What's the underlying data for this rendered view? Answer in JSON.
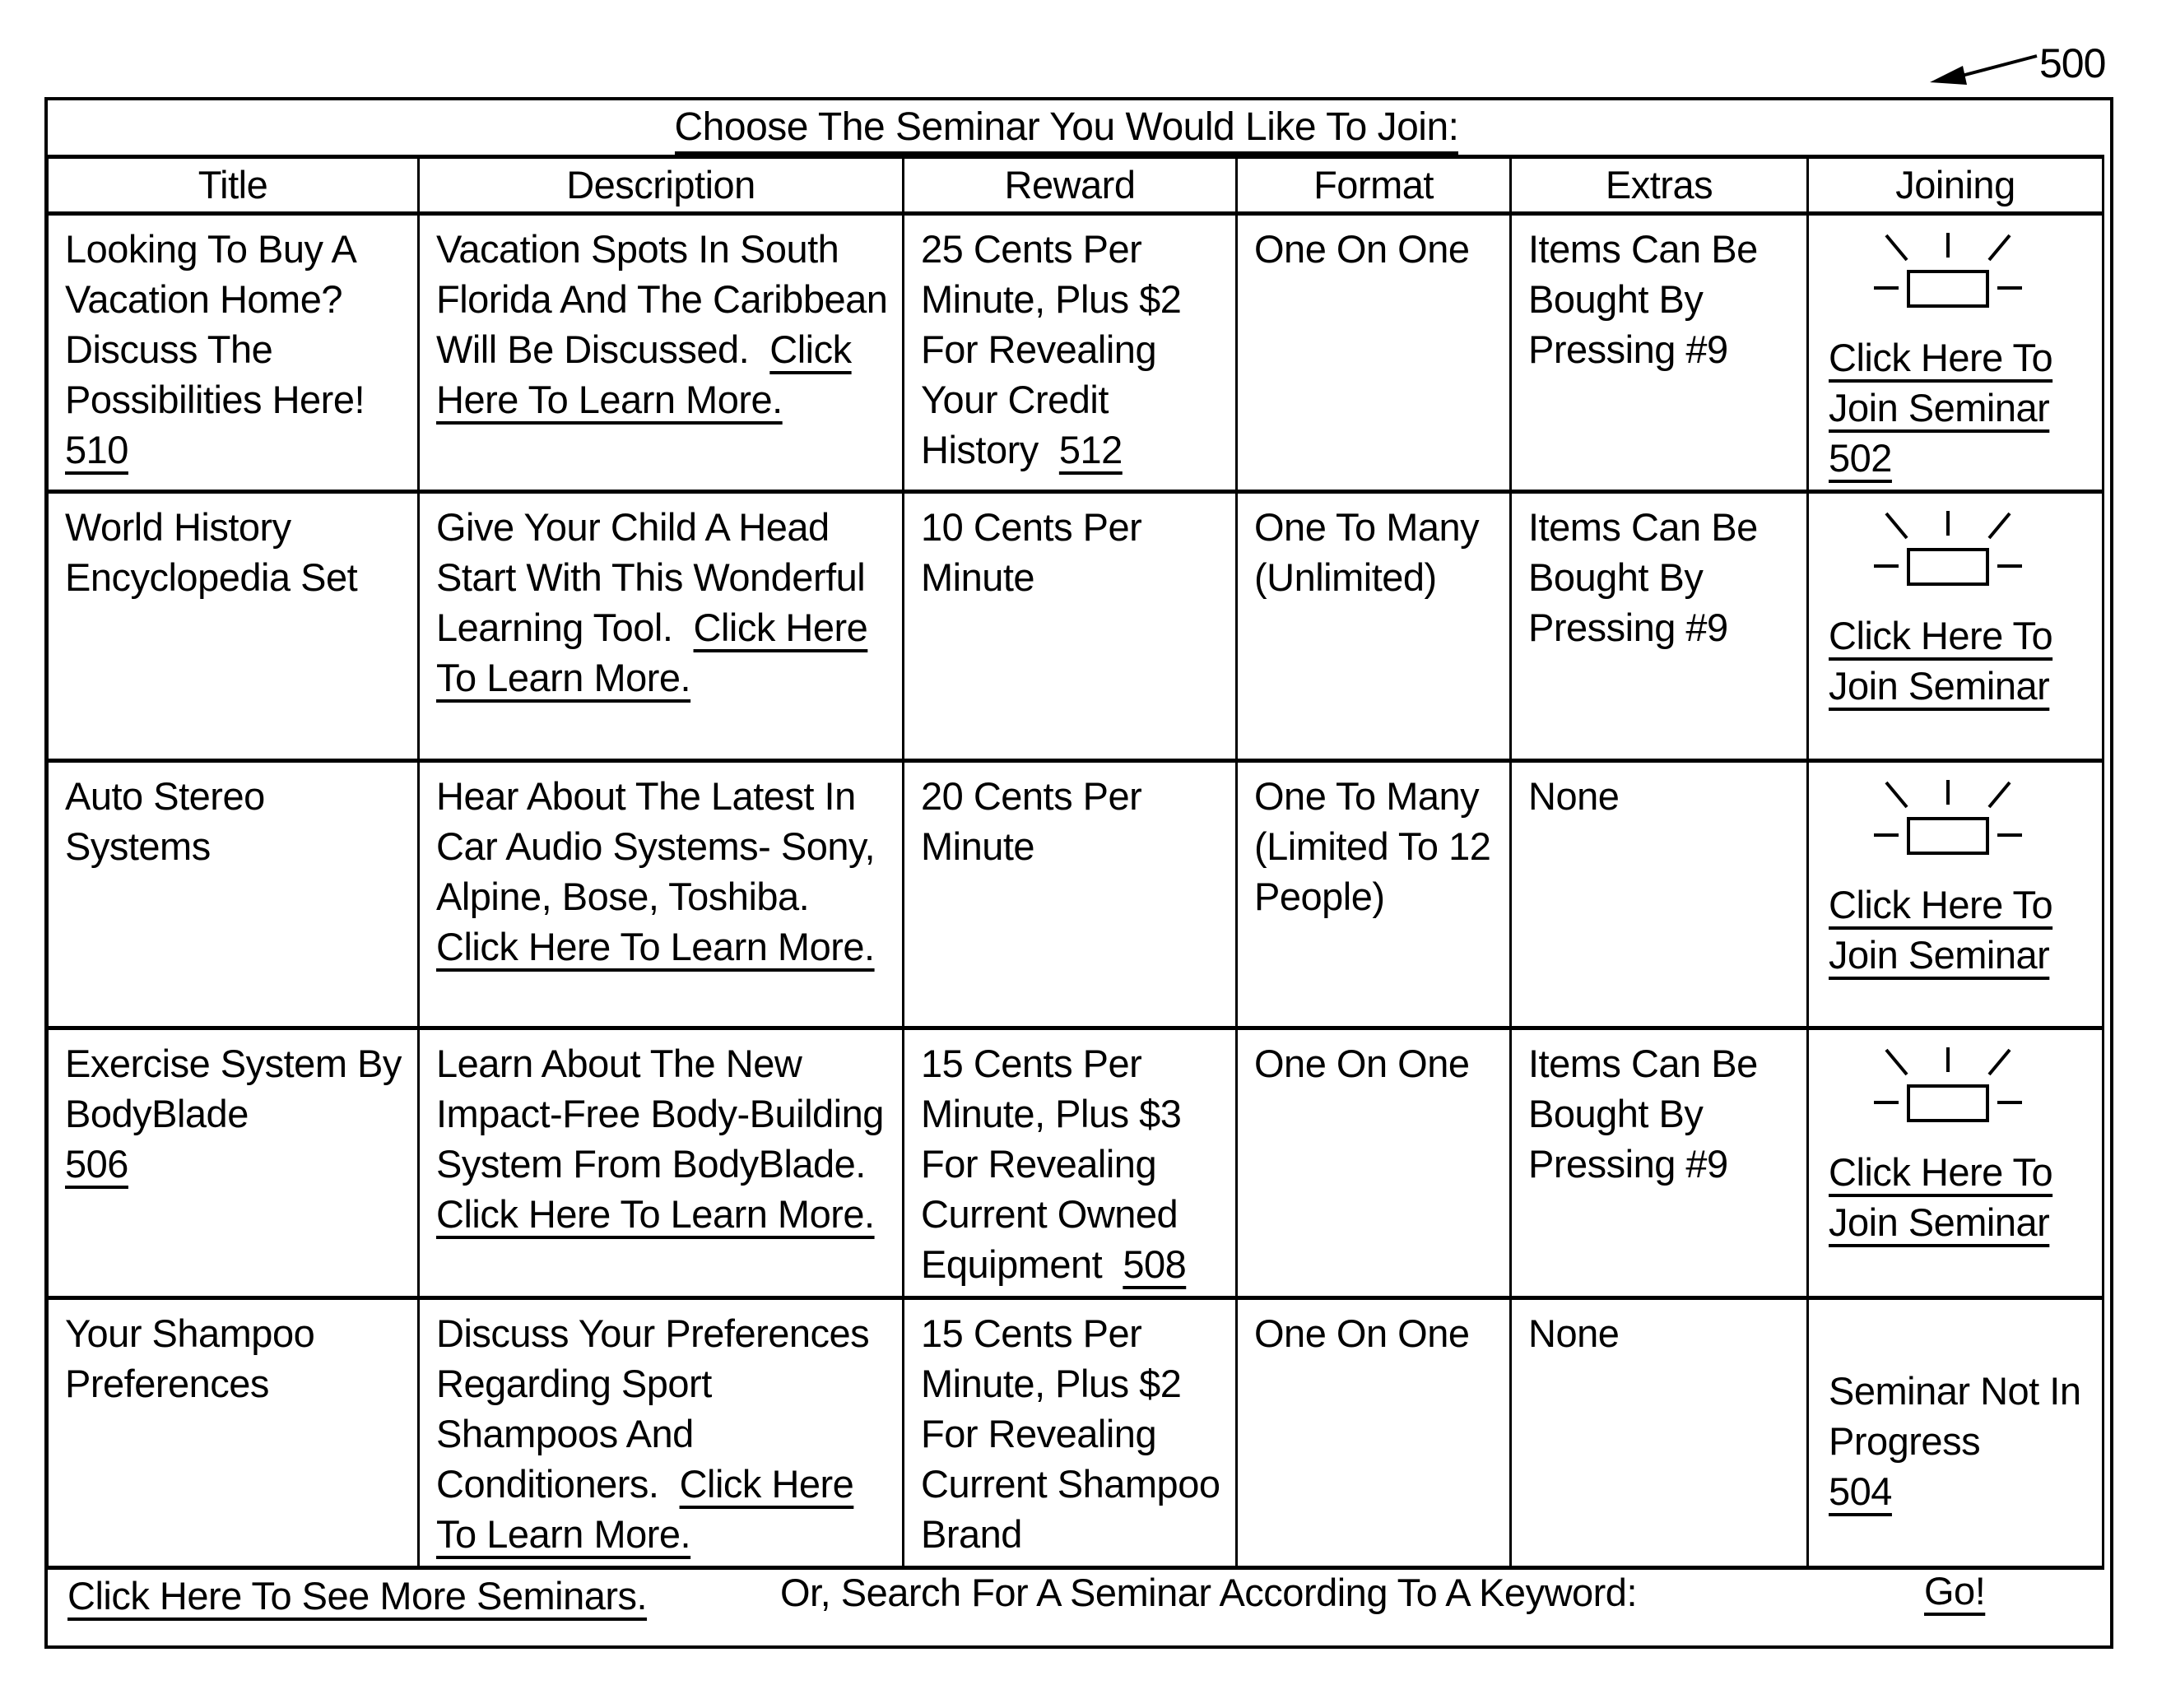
{
  "figure": {
    "reference_number": "500"
  },
  "panel": {
    "heading": "Choose The Seminar You Would Like To Join:",
    "columns": [
      "Title",
      "Description",
      "Reward",
      "Format",
      "Extras",
      "Joining"
    ],
    "rows": [
      {
        "title": "Looking To Buy A Vacation Home? Discuss The Possibilities Here!",
        "title_ref": "510",
        "description": "Vacation Spots In South Florida And The Caribbean Will Be Discussed.",
        "learn_more": "Click Here To Learn More.",
        "reward": "25 Cents Per Minute, Plus $2 For Revealing Your Credit History",
        "reward_ref": "512",
        "format": "One On One",
        "extras": "Items Can Be Bought By Pressing #9",
        "joining": {
          "type": "active",
          "icon": "signal-light-icon",
          "label": "Click Here To Join Seminar",
          "ref": "502"
        }
      },
      {
        "title": "World History Encyclopedia Set",
        "title_ref": "",
        "description": "Give Your Child A Head Start With This Wonderful Learning Tool.",
        "learn_more": "Click Here To Learn More.",
        "reward": "10 Cents Per Minute",
        "reward_ref": "",
        "format": "One To Many (Unlimited)",
        "extras": "Items Can Be Bought By Pressing #9",
        "joining": {
          "type": "active",
          "icon": "signal-light-icon",
          "label": "Click Here To Join Seminar",
          "ref": ""
        }
      },
      {
        "title": "Auto Stereo Systems",
        "title_ref": "",
        "description": "Hear About The Latest In Car Audio Systems- Sony, Alpine, Bose, Toshiba.",
        "learn_more": "Click Here To Learn More.",
        "reward": "20 Cents Per Minute",
        "reward_ref": "",
        "format": "One To Many (Limited To 12 People)",
        "extras": "None",
        "joining": {
          "type": "active",
          "icon": "signal-light-icon",
          "label": "Click Here To Join Seminar",
          "ref": ""
        }
      },
      {
        "title": "Exercise System By BodyBlade",
        "title_ref": "506",
        "description": "Learn About The New Impact-Free Body-Building System From BodyBlade.",
        "learn_more": "Click Here To Learn More.",
        "reward": "15 Cents Per Minute, Plus $3 For Revealing Current Owned Equipment",
        "reward_ref": "508",
        "format": "One On One",
        "extras": "Items Can Be Bought By Pressing #9",
        "joining": {
          "type": "active",
          "icon": "signal-light-icon",
          "label": "Click Here To Join Seminar",
          "ref": ""
        }
      },
      {
        "title": "Your Shampoo Preferences",
        "title_ref": "",
        "description": "Discuss Your Preferences Regarding Sport Shampoos And Conditioners.",
        "learn_more": "Click Here To Learn More.",
        "reward": "15 Cents Per Minute, Plus $2 For Revealing Current Shampoo Brand",
        "reward_ref": "",
        "format": "One On One",
        "extras": "None",
        "joining": {
          "type": "inactive",
          "label": "Seminar Not In Progress",
          "ref": "504"
        }
      }
    ]
  },
  "footer": {
    "more_link": "Click Here To See More Seminars.",
    "search_prompt": "Or, Search For A Seminar According To A Keyword:",
    "go_button": "Go!"
  }
}
